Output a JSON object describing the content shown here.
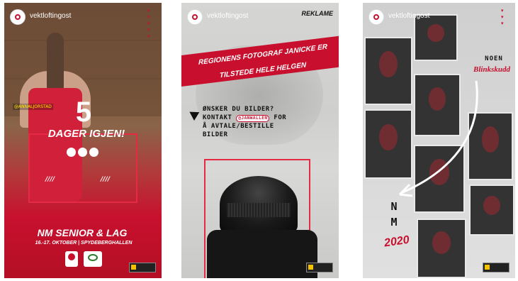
{
  "account": "vektloftingost",
  "story1": {
    "tag": "@ANNALJORSTAD",
    "countdown_number": "5",
    "countdown_text": "DAGER IGJEN!",
    "slash_left": "////",
    "slash_right": "////",
    "event": "NM SENIOR & LAG",
    "date_venue": "16.-17. OKTOBER | SPYDEBERGHALLEN"
  },
  "story2": {
    "badge": "REKLAME",
    "banner_line1": "REGIONENS FOTOGRAF JANICKE ER",
    "banner_line2": "TILSTEDE HELE HELGEN",
    "question": "ØNSKER DU BILDER?",
    "contact_prefix": "KONTAKT",
    "handle": "@JANWALLEN",
    "contact_suffix": "FOR",
    "contact_line3": "Å AVTALE/BESTILLE",
    "contact_line4": "BILDER"
  },
  "story3": {
    "noen": "NOEN",
    "blinkskudd": "Blinkskudd",
    "nm_n": "N",
    "nm_m": "M",
    "year": "2020"
  },
  "colors": {
    "brand_red": "#c8102e",
    "text_white": "#ffffff"
  }
}
